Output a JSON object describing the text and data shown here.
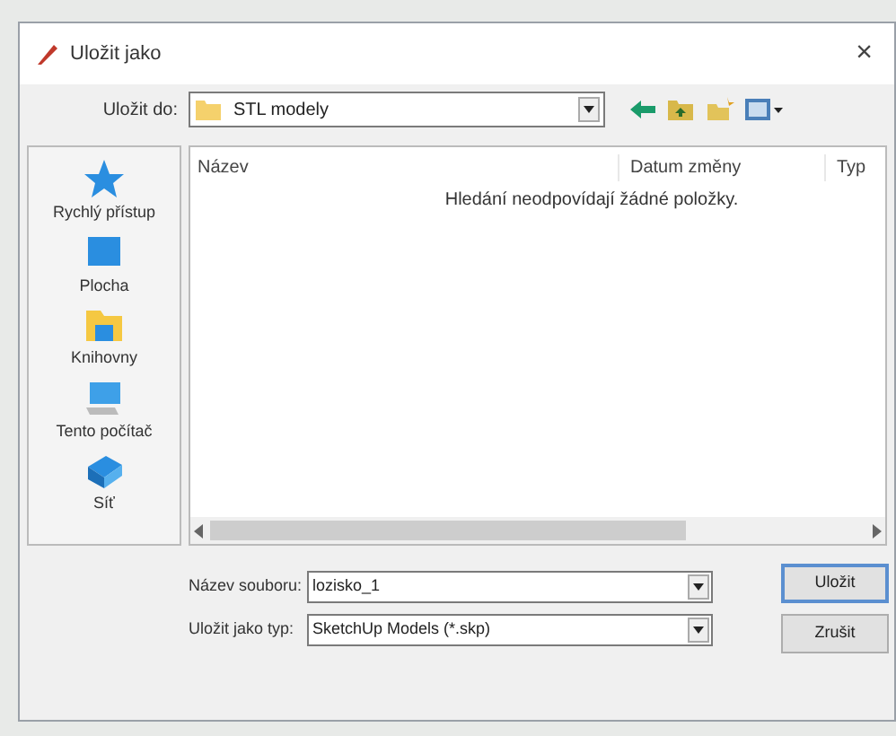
{
  "window": {
    "title": "Uložit jako",
    "close": "×"
  },
  "location": {
    "label": "Uložit do:",
    "value": "STL modely"
  },
  "sidebar": {
    "items": [
      {
        "label": "Rychlý přístup",
        "kind": "star"
      },
      {
        "label": "Plocha",
        "kind": "desktop"
      },
      {
        "label": "Knihovny",
        "kind": "library"
      },
      {
        "label": "Tento počítač",
        "kind": "computer"
      },
      {
        "label": "Síť",
        "kind": "network"
      }
    ]
  },
  "file_list": {
    "columns": [
      "Název",
      "Datum změny",
      "Typ"
    ],
    "empty_message": "Hledání neodpovídají žádné položky."
  },
  "filename": {
    "label": "Název souboru:",
    "value": "lozisko_1"
  },
  "filetype": {
    "label": "Uložit jako typ:",
    "value": "SketchUp Models (*.skp)"
  },
  "buttons": [
    "Uložit",
    "Zrušit"
  ]
}
